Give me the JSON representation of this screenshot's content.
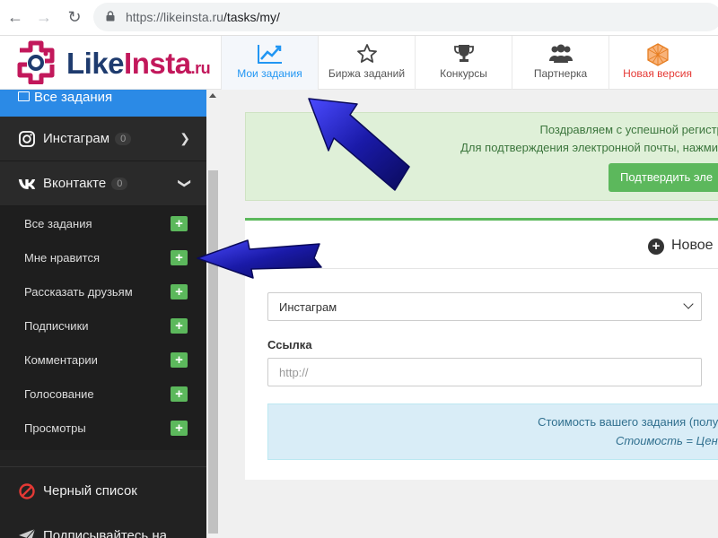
{
  "browser": {
    "url_host": "https://likeinsta.ru",
    "url_path": "/tasks/my/"
  },
  "logo": {
    "like": "Like",
    "insta": "Insta",
    "ru": ".ru"
  },
  "topnav": [
    {
      "label": "Мои задания",
      "icon": "chart-icon",
      "active": true
    },
    {
      "label": "Биржа заданий",
      "icon": "star-icon"
    },
    {
      "label": "Конкурсы",
      "icon": "trophy-icon"
    },
    {
      "label": "Партнерка",
      "icon": "users-icon"
    },
    {
      "label": "Новая версия",
      "icon": "polyhedron-icon"
    }
  ],
  "sidebar": {
    "all_tasks": "Все задания",
    "instagram": {
      "label": "Инстаграм",
      "badge": "0"
    },
    "vkontakte": {
      "label": "Вконтакте",
      "badge": "0"
    },
    "sub_items": [
      "Все задания",
      "Мне нравится",
      "Рассказать друзьям",
      "Подписчики",
      "Комментарии",
      "Голосование",
      "Просмотры"
    ],
    "blacklist": "Черный список",
    "subscribe": "Подписывайтесь на"
  },
  "alert": {
    "line1": "Поздравляем с успешной регистра",
    "line2": "Для подтверждения электронной почты, нажмите",
    "button": "Подтвердить эле"
  },
  "panel": {
    "title": "Новое",
    "select_value": "Инстаграм",
    "link_label": "Ссылка",
    "link_placeholder": "http://",
    "info_line1": "Стоимость вашего задания (получ",
    "info_line2": "Стоимость = Цена"
  },
  "colors": {
    "accent": "#2b8ae6",
    "sidebar_bg": "#222222",
    "success": "#5cb85c",
    "brand_pink": "#c2185b",
    "brand_navy": "#1e3b6e",
    "annotation_arrow": "#1a1aa8"
  }
}
